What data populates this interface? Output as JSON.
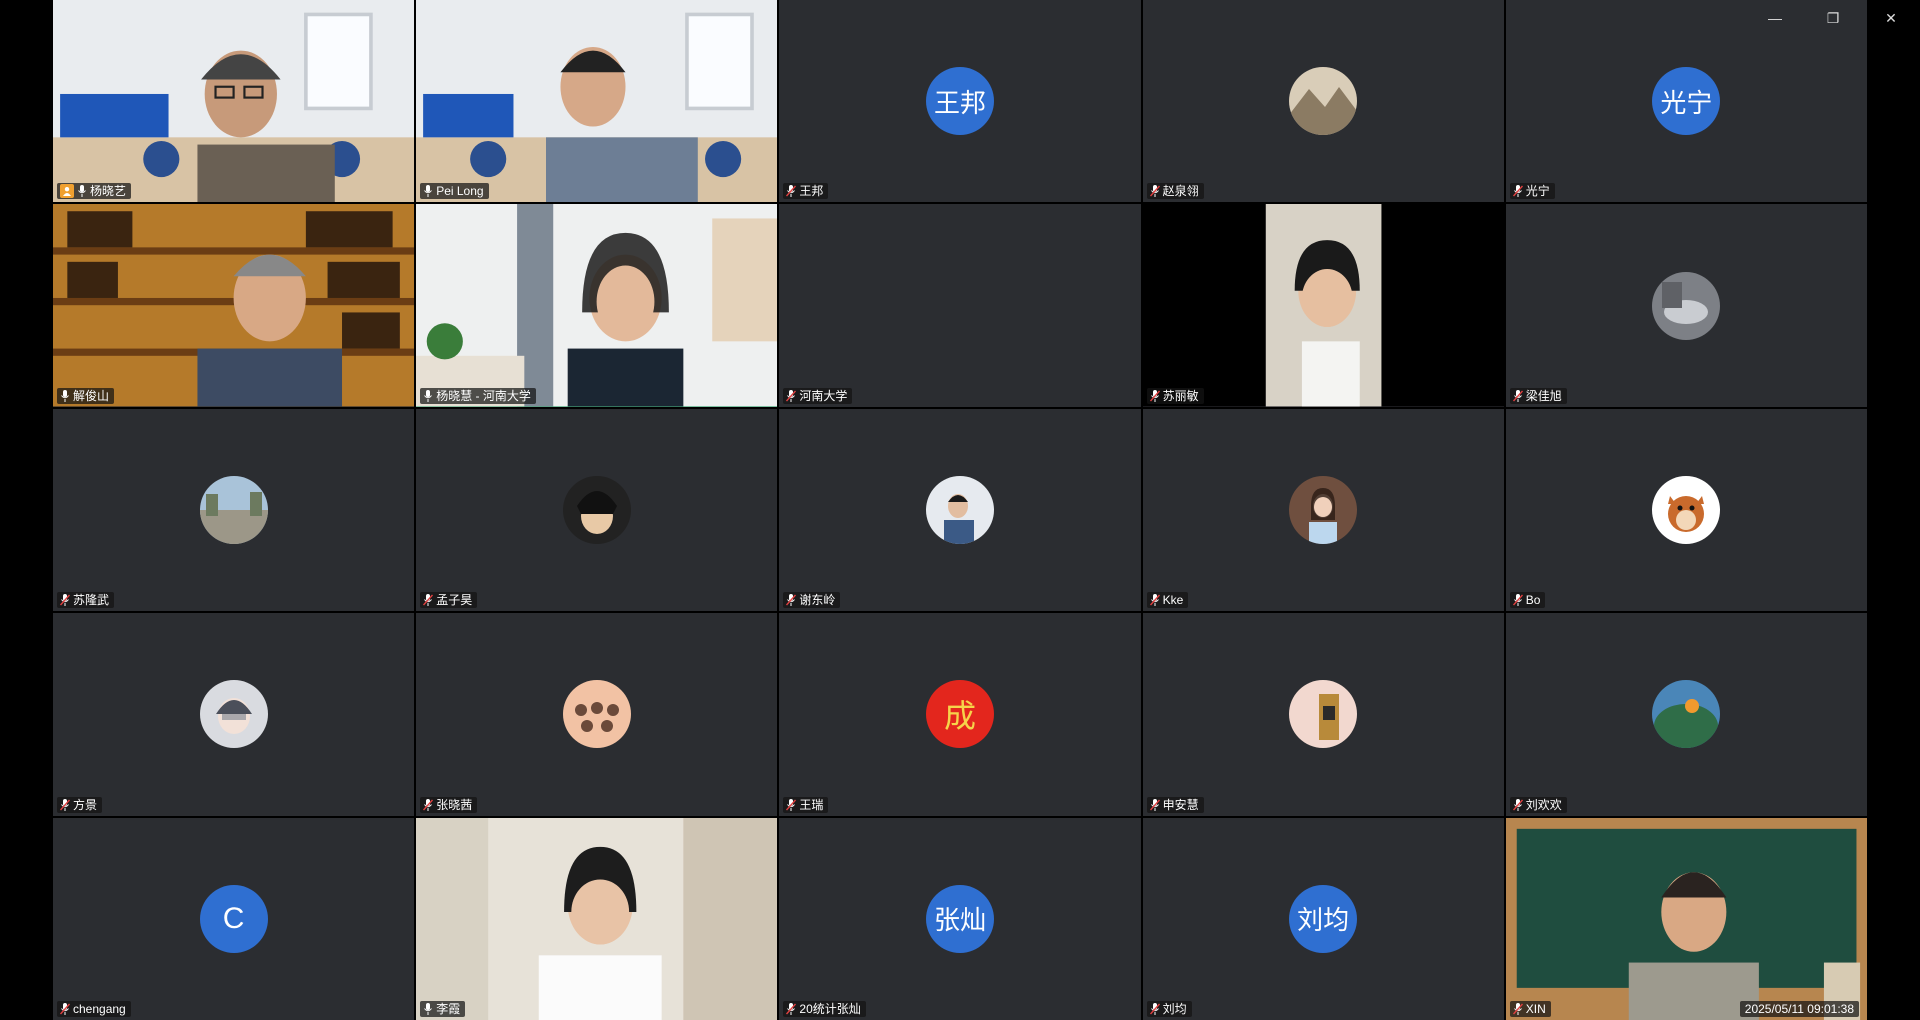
{
  "window": {
    "controls": {
      "minimize": "—",
      "restore": "❐",
      "close": "✕"
    }
  },
  "colors": {
    "tile_bg": "#2b2d31",
    "avatar_blue": "#2f6fd1",
    "active_border": "#2f9e6a",
    "speaker_border": "#d9a25a",
    "host_badge": "#f0a030"
  },
  "tiles": [
    {
      "name": "杨晓艺",
      "type": "video",
      "host": true,
      "mic": "on",
      "scene": "office-man-1"
    },
    {
      "name": "Pei Long",
      "type": "video",
      "mic": "on",
      "scene": "office-man-2"
    },
    {
      "name": "王邦",
      "type": "initials",
      "initials": "王邦",
      "mic": "off"
    },
    {
      "name": "赵泉翎",
      "type": "photo-avatar",
      "icon": "avatar-landscape-icon",
      "mic": "off"
    },
    {
      "name": "光宁",
      "type": "initials",
      "initials": "光宁",
      "mic": "off"
    },
    {
      "name": "解俊山",
      "type": "video",
      "mic": "on",
      "scene": "bookshelf-man"
    },
    {
      "name": "杨晓慧 - 河南大学",
      "type": "video",
      "mic": "on",
      "active": true,
      "scene": "room-woman"
    },
    {
      "name": "河南大学",
      "type": "empty",
      "mic": "off"
    },
    {
      "name": "苏丽敏",
      "type": "video",
      "mic": "off",
      "scene": "phone-woman"
    },
    {
      "name": "梁佳旭",
      "type": "photo-avatar",
      "icon": "avatar-hand-icon",
      "mic": "off"
    },
    {
      "name": "苏隆武",
      "type": "photo-avatar",
      "icon": "avatar-street-icon",
      "mic": "off"
    },
    {
      "name": "孟子昊",
      "type": "photo-avatar",
      "icon": "avatar-anime-icon",
      "mic": "off"
    },
    {
      "name": "谢东岭",
      "type": "photo-avatar",
      "icon": "avatar-person-icon",
      "mic": "off"
    },
    {
      "name": "Kke",
      "type": "photo-avatar",
      "icon": "avatar-girl-icon",
      "mic": "off"
    },
    {
      "name": "Bo",
      "type": "photo-avatar",
      "icon": "avatar-squirrel-icon",
      "mic": "off"
    },
    {
      "name": "方景",
      "type": "photo-avatar",
      "icon": "avatar-cartoon-icon",
      "mic": "off"
    },
    {
      "name": "张晓茜",
      "type": "photo-avatar",
      "icon": "avatar-group-icon",
      "mic": "off"
    },
    {
      "name": "王瑞",
      "type": "photo-avatar",
      "icon": "avatar-cheng-icon",
      "glyph": "成",
      "mic": "off"
    },
    {
      "name": "申安慧",
      "type": "photo-avatar",
      "icon": "avatar-booth-icon",
      "mic": "off"
    },
    {
      "name": "刘欢欢",
      "type": "photo-avatar",
      "icon": "avatar-earth-icon",
      "mic": "off"
    },
    {
      "name": "chengang",
      "type": "initials",
      "initials": "C",
      "mic": "off"
    },
    {
      "name": "李霞",
      "type": "video",
      "mic": "on",
      "scene": "white-woman"
    },
    {
      "name": "20统计张灿",
      "type": "initials",
      "initials": "张灿",
      "mic": "off"
    },
    {
      "name": "刘均",
      "type": "initials",
      "initials": "刘均",
      "mic": "off"
    },
    {
      "name": "XIN",
      "type": "video",
      "mic": "off",
      "speaking": true,
      "scene": "chalkboard-woman",
      "timestamp": "2025/05/11 09:01:38"
    }
  ]
}
